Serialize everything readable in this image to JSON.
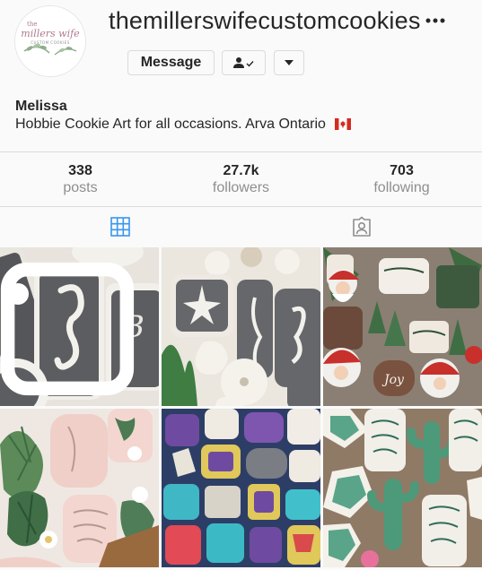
{
  "profile": {
    "username": "themillerswifecustomcookies",
    "message_label": "Message",
    "name": "Melissa",
    "bio": "Hobbie Cookie Art for all occasions. Arva Ontario",
    "avatar_text": {
      "line1": "the",
      "line2": "millers wife",
      "line3": "CUSTOM COOKIES"
    }
  },
  "stats": [
    {
      "value": "338",
      "label": "posts"
    },
    {
      "value": "27.7k",
      "label": "followers"
    },
    {
      "value": "703",
      "label": "following"
    }
  ],
  "tabs": [
    {
      "icon": "grid-icon"
    },
    {
      "icon": "tagged-icon"
    }
  ],
  "posts": [
    {
      "theme": "seahorse-gray-cookies",
      "multi": true
    },
    {
      "theme": "starfish-sand-dollar-cookies",
      "multi": false
    },
    {
      "theme": "christmas-santa-cookies",
      "multi": false
    },
    {
      "theme": "pink-leaf-cookies",
      "multi": false
    },
    {
      "theme": "friends-tv-cookies",
      "multi": false
    },
    {
      "theme": "cactus-cookies",
      "multi": false
    }
  ],
  "colors": {
    "text": "#262626",
    "muted": "#8e8e8e",
    "border": "#dbdbdb",
    "background": "#fafafa"
  }
}
